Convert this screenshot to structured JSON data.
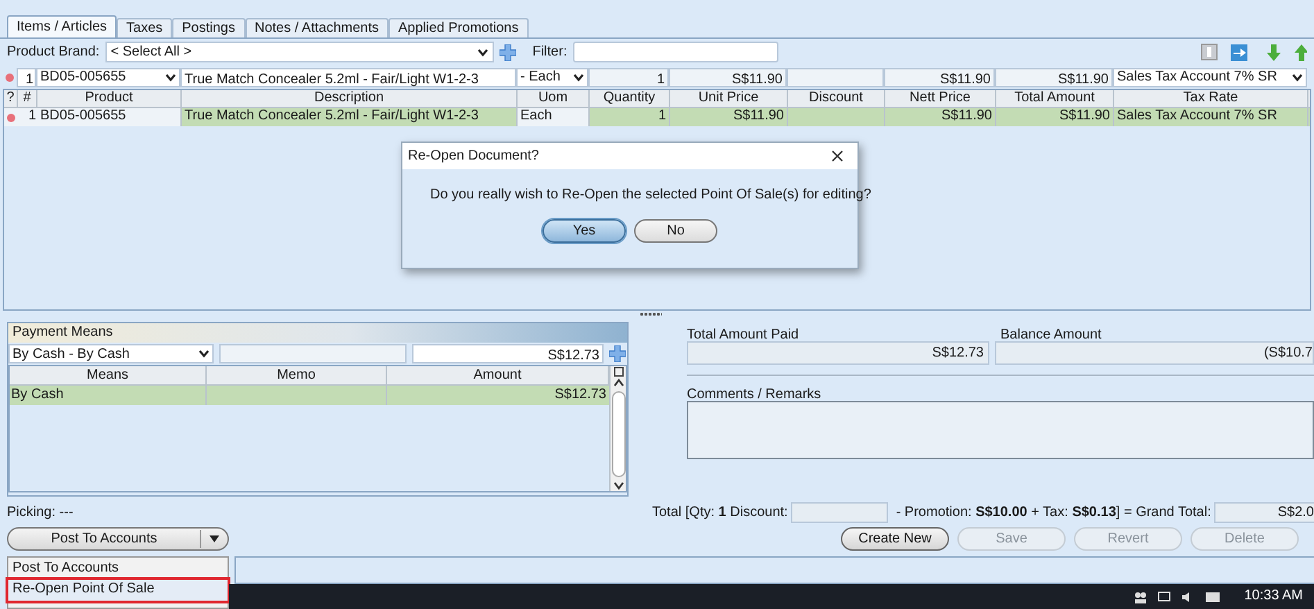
{
  "tabs": [
    {
      "label": "Items / Articles",
      "selected": true
    },
    {
      "label": "Taxes",
      "selected": false
    },
    {
      "label": "Postings",
      "selected": false
    },
    {
      "label": "Notes / Attachments",
      "selected": false
    },
    {
      "label": "Applied Promotions",
      "selected": false
    }
  ],
  "filter_bar": {
    "brand_label": "Product Brand:",
    "brand_value": "< Select All >",
    "filter_label": "Filter:"
  },
  "entry_row": {
    "line": "1",
    "product": "BD05-005655",
    "description": "True Match Concealer 5.2ml - Fair/Light W1-2-3",
    "uom": "- Each",
    "quantity": "1",
    "unit_price": "S$11.90",
    "nett_price": "S$11.90",
    "total_amount": "S$11.90",
    "tax_rate": "Sales Tax Account 7% SR"
  },
  "table": {
    "columns": [
      "?",
      "#",
      "Product",
      "Description",
      "Uom",
      "Quantity",
      "Unit Price",
      "Discount",
      "Nett Price",
      "Total Amount",
      "Tax Rate"
    ],
    "rows": [
      {
        "selected": true,
        "number": "1",
        "product": "BD05-005655",
        "description": "True Match Concealer 5.2ml - Fair/Light W1-2-3",
        "uom": "Each",
        "quantity": "1",
        "unit_price": "S$11.90",
        "nett_price": "S$11.90",
        "total_amount": "S$11.90",
        "tax_rate": "Sales Tax Account 7% SR"
      }
    ]
  },
  "dialog": {
    "title": "Re-Open Document?",
    "message": "Do you really wish to Re-Open the selected Point Of Sale(s) for editing?",
    "buttons": [
      {
        "label": "Yes",
        "default": true
      },
      {
        "label": "No",
        "default": false
      }
    ]
  },
  "payment": {
    "title": "Payment Means",
    "means_value": "By Cash - By Cash",
    "amount_value": "S$12.73",
    "columns": [
      "Means",
      "Memo",
      "Amount"
    ],
    "rows": [
      {
        "selected": true,
        "means": "By Cash",
        "amount": "S$12.73"
      }
    ]
  },
  "picking": "Picking: ---",
  "summary": {
    "paid_label": "Total Amount Paid",
    "paid_value": "S$12.73",
    "balance_label": "Balance Amount",
    "balance_value": "(S$10.7",
    "comments_label": "Comments / Remarks"
  },
  "totals": {
    "prefix": "Total [Qty: **1** Discount:",
    "middle": "- Promotion: **S$10.00** + Tax: **S$0.13**] = Grand Total:",
    "grand_total": "S$2.0"
  },
  "post_button": {
    "label": "Post To Accounts"
  },
  "actions": [
    {
      "label": "Create New",
      "disabled": false
    },
    {
      "label": "Save",
      "disabled": true
    },
    {
      "label": "Revert",
      "disabled": true
    },
    {
      "label": "Delete",
      "disabled": true
    }
  ],
  "menu": [
    {
      "label": "Post To Accounts",
      "selected": false
    },
    {
      "label": "Re-Open Point Of Sale",
      "selected": true
    }
  ],
  "taskbar": {
    "time": "10:33 AM"
  }
}
